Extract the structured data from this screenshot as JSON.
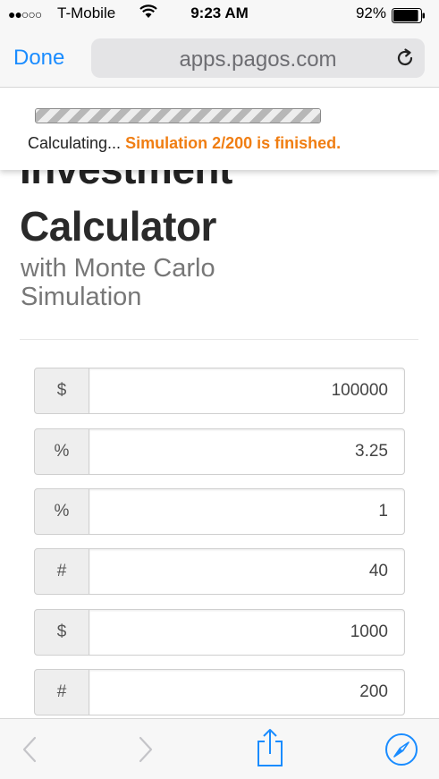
{
  "status_bar": {
    "signal": "●●○○○",
    "carrier": "T-Mobile",
    "time": "9:23 AM",
    "battery_percent": "92%",
    "battery_level": 0.92
  },
  "nav": {
    "done_label": "Done",
    "url": "apps.pagos.com"
  },
  "progress": {
    "label": "Calculating...",
    "status": "Simulation 2/200 is finished.",
    "fill": 1.0,
    "accent_color": "#f07e13"
  },
  "header": {
    "title_line1": "Investment",
    "title_line2": "Calculator",
    "subtitle": "with Monte Carlo Simulation"
  },
  "fields": [
    {
      "addon": "$",
      "value": "100000"
    },
    {
      "addon": "%",
      "value": "3.25"
    },
    {
      "addon": "%",
      "value": "1"
    },
    {
      "addon": "#",
      "value": "40"
    },
    {
      "addon": "$",
      "value": "1000"
    },
    {
      "addon": "#",
      "value": "200"
    }
  ],
  "toolbar": {
    "back_icon": "chevron-left-icon",
    "forward_icon": "chevron-right-icon",
    "share_icon": "share-icon",
    "safari_icon": "compass-icon",
    "accent_color": "#1a8cff"
  }
}
